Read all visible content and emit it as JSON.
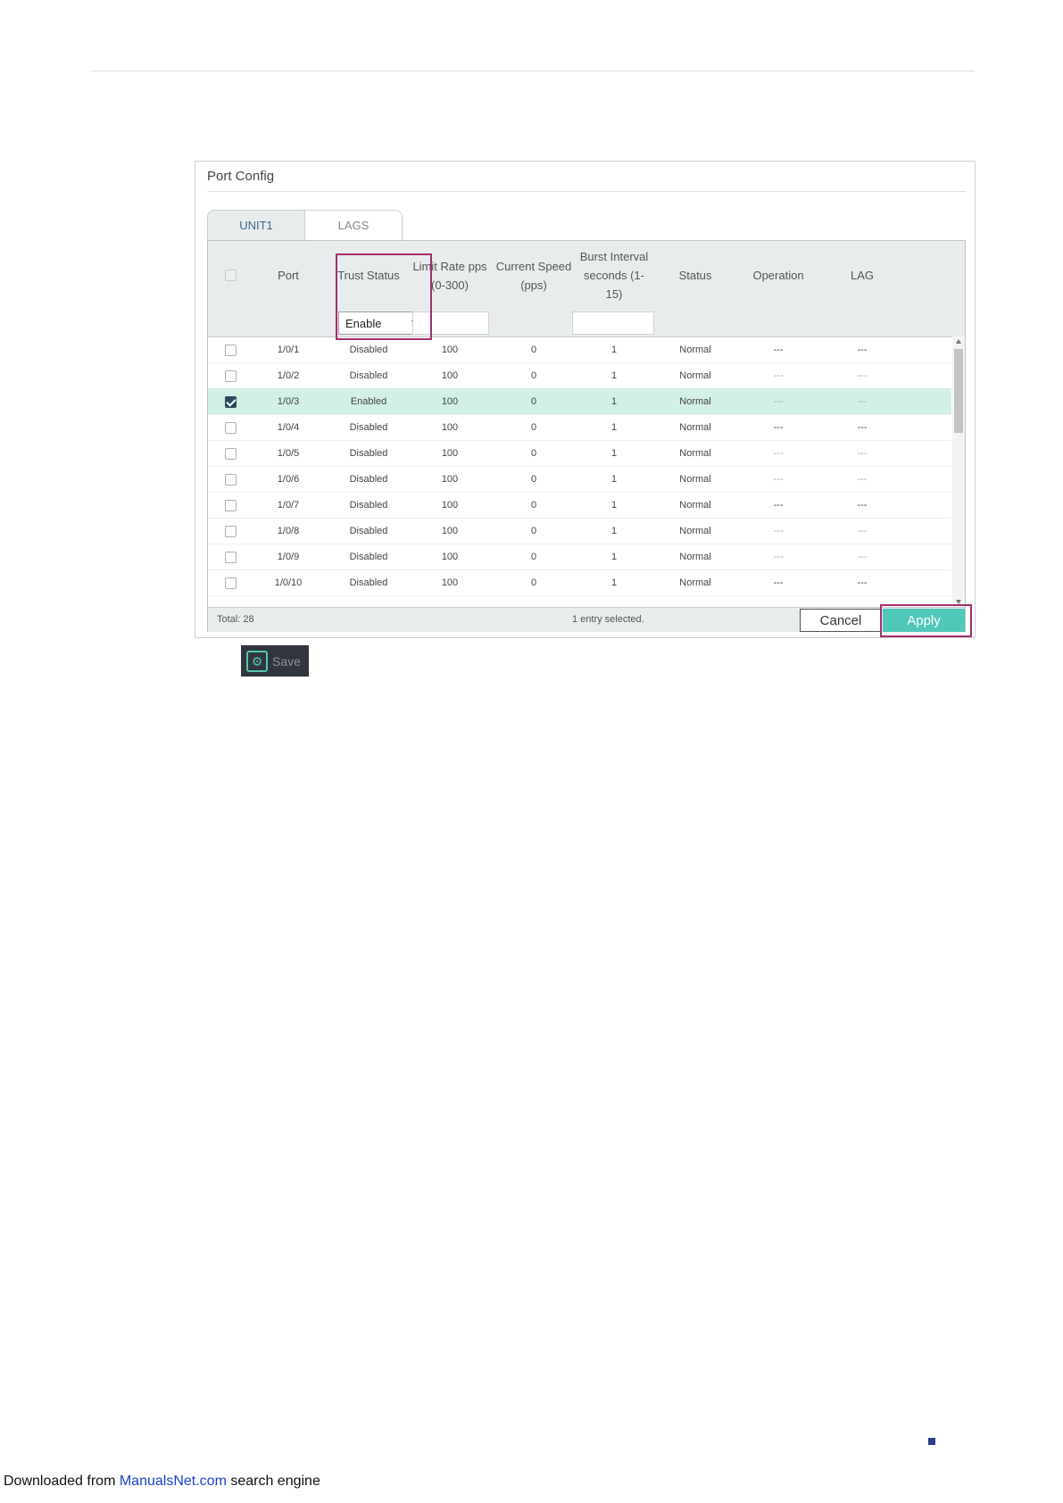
{
  "panel": {
    "title": "Port Config",
    "tabs": [
      {
        "label": "UNIT1",
        "active": true
      },
      {
        "label": "LAGS",
        "active": false
      }
    ]
  },
  "table": {
    "columns": {
      "port": "Port",
      "trust_status": "Trust Status",
      "limit_rate": "Limit Rate pps (0-300)",
      "current_speed": "Current Speed (pps)",
      "burst_interval": "Burst Interval seconds (1-15)",
      "status": "Status",
      "operation": "Operation",
      "lag": "LAG"
    },
    "edit_row": {
      "trust_status_value": "Enable"
    },
    "rows": [
      {
        "port": "1/0/1",
        "trust": "Disabled",
        "rate": "100",
        "speed": "0",
        "burst": "1",
        "status": "Normal",
        "operation": "---",
        "lag": "---",
        "checked": false
      },
      {
        "port": "1/0/2",
        "trust": "Disabled",
        "rate": "100",
        "speed": "0",
        "burst": "1",
        "status": "Normal",
        "operation": "---",
        "lag": "---",
        "checked": false
      },
      {
        "port": "1/0/3",
        "trust": "Enabled",
        "rate": "100",
        "speed": "0",
        "burst": "1",
        "status": "Normal",
        "operation": "---",
        "lag": "---",
        "checked": true
      },
      {
        "port": "1/0/4",
        "trust": "Disabled",
        "rate": "100",
        "speed": "0",
        "burst": "1",
        "status": "Normal",
        "operation": "---",
        "lag": "---",
        "checked": false
      },
      {
        "port": "1/0/5",
        "trust": "Disabled",
        "rate": "100",
        "speed": "0",
        "burst": "1",
        "status": "Normal",
        "operation": "---",
        "lag": "---",
        "checked": false
      },
      {
        "port": "1/0/6",
        "trust": "Disabled",
        "rate": "100",
        "speed": "0",
        "burst": "1",
        "status": "Normal",
        "operation": "---",
        "lag": "---",
        "checked": false
      },
      {
        "port": "1/0/7",
        "trust": "Disabled",
        "rate": "100",
        "speed": "0",
        "burst": "1",
        "status": "Normal",
        "operation": "---",
        "lag": "---",
        "checked": false
      },
      {
        "port": "1/0/8",
        "trust": "Disabled",
        "rate": "100",
        "speed": "0",
        "burst": "1",
        "status": "Normal",
        "operation": "---",
        "lag": "---",
        "checked": false
      },
      {
        "port": "1/0/9",
        "trust": "Disabled",
        "rate": "100",
        "speed": "0",
        "burst": "1",
        "status": "Normal",
        "operation": "---",
        "lag": "---",
        "checked": false
      },
      {
        "port": "1/0/10",
        "trust": "Disabled",
        "rate": "100",
        "speed": "0",
        "burst": "1",
        "status": "Normal",
        "operation": "---",
        "lag": "---",
        "checked": false
      }
    ],
    "footer": {
      "total": "Total: 28",
      "selected": "1 entry selected.",
      "cancel_label": "Cancel",
      "apply_label": "Apply"
    }
  },
  "save_button": {
    "label": "Save",
    "icon": "save-gear-icon"
  },
  "page_footer": {
    "prefix": "Downloaded from ",
    "link": "ManualsNet.com",
    "suffix": " search engine"
  },
  "colors": {
    "accent": "#4fc7b9",
    "highlight_box": "#a32e6e",
    "selected_row": "#d2efe8",
    "save_bg": "#30363c"
  }
}
